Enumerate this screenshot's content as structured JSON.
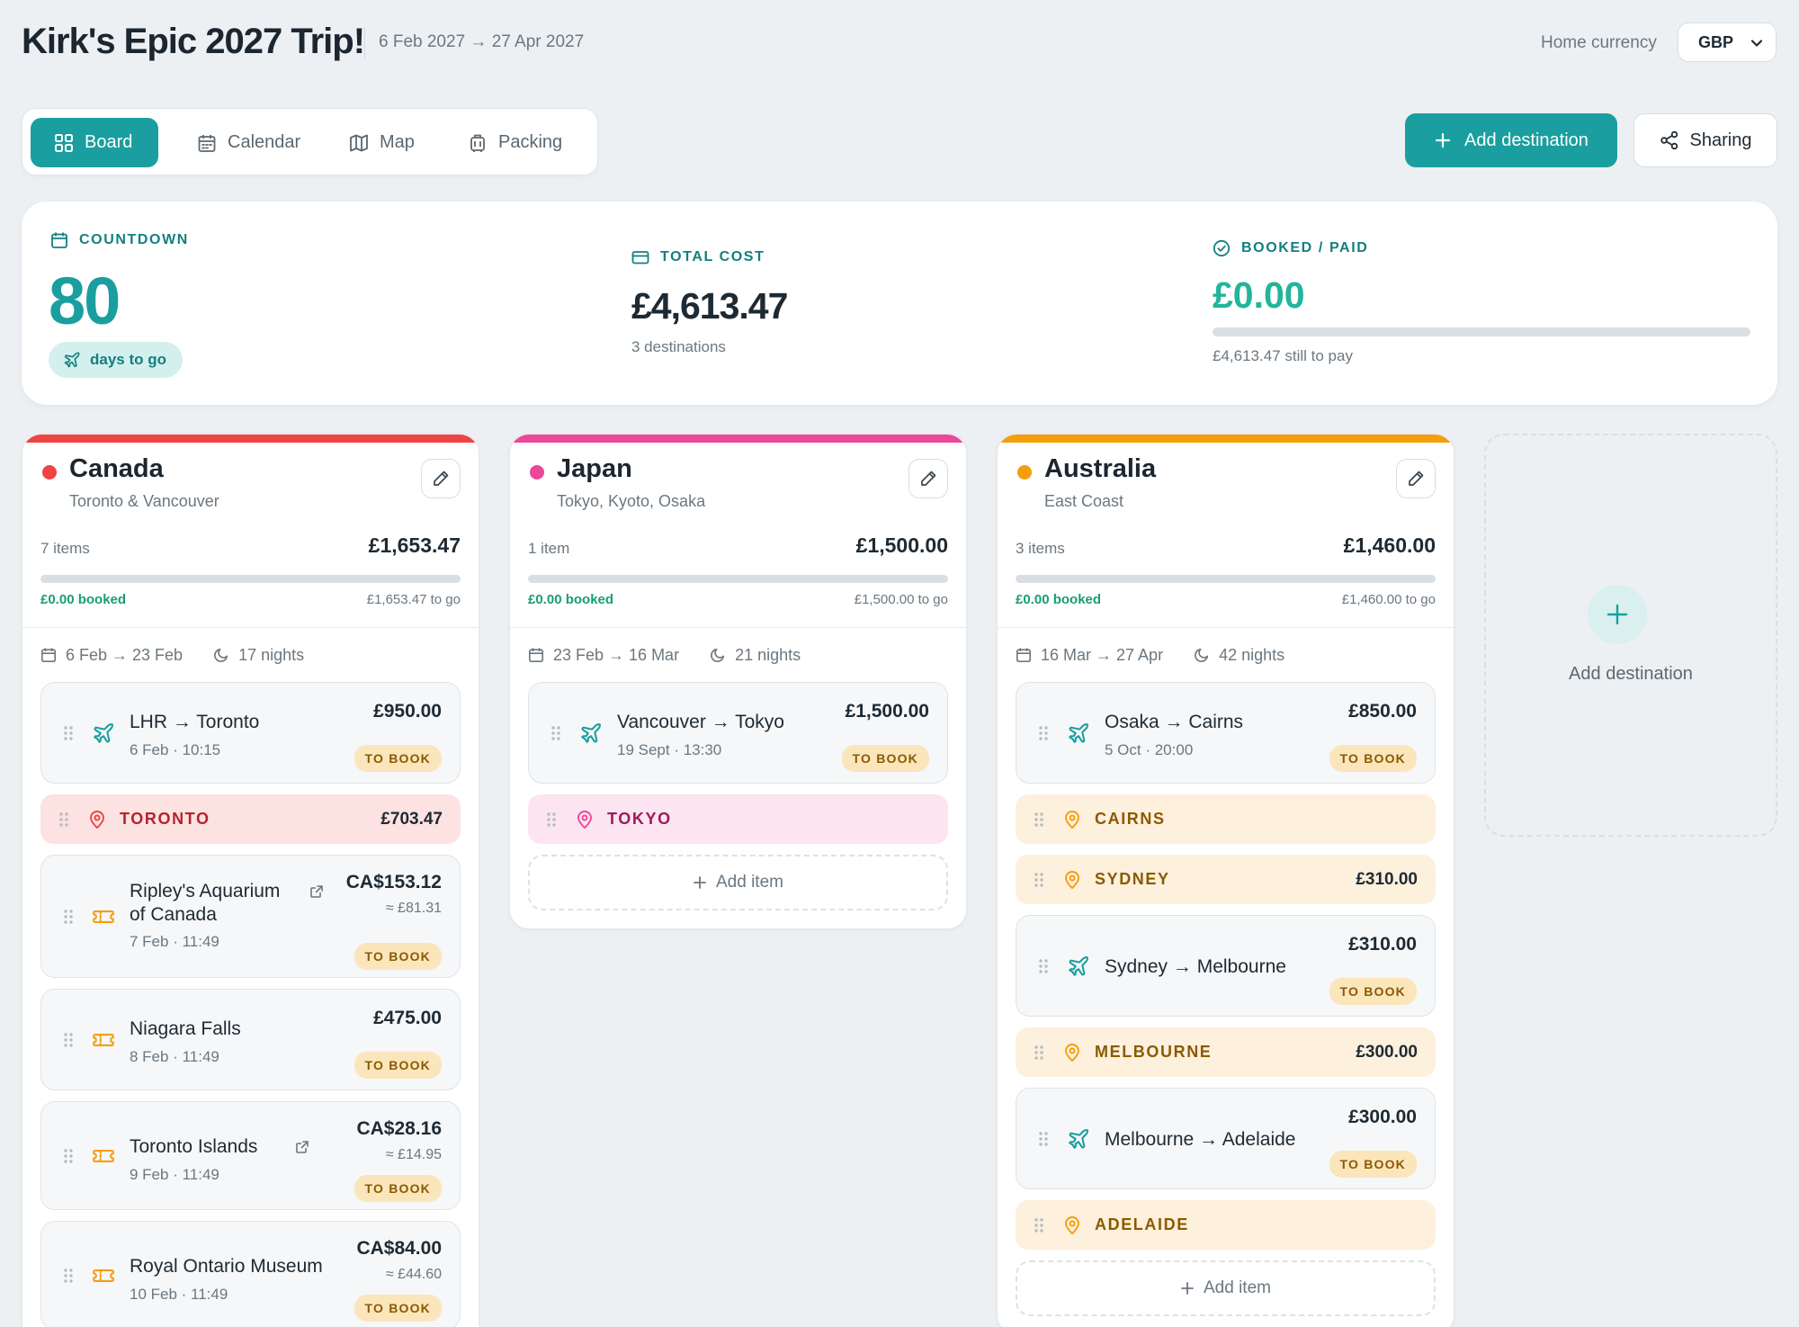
{
  "header": {
    "title": "Kirk's Epic 2027 Trip!",
    "dates": "6 Feb 2027 → 27 Apr 2027",
    "currency_label": "Home currency",
    "currency_value": "GBP"
  },
  "tabs": [
    {
      "label": "Board",
      "icon": "grid-icon",
      "active": true
    },
    {
      "label": "Calendar",
      "icon": "calendar-icon",
      "active": false
    },
    {
      "label": "Map",
      "icon": "map-icon",
      "active": false
    },
    {
      "label": "Packing",
      "icon": "luggage-icon",
      "active": false
    }
  ],
  "actions": {
    "add_destination": "Add destination",
    "sharing": "Sharing"
  },
  "summary": {
    "countdown_label": "COUNTDOWN",
    "countdown_value": "80",
    "countdown_pill": "days to go",
    "total_label": "TOTAL COST",
    "total_value": "£4,613.47",
    "total_sub": "3 destinations",
    "paid_label": "BOOKED / PAID",
    "paid_value": "£0.00",
    "paid_fraction": 0,
    "paid_sub": "£4,613.47 still to pay"
  },
  "colors": {
    "accent": "#1a9e9f",
    "canada": "#ef4444",
    "japan": "#ec4899",
    "australia": "#f59e0b"
  },
  "columns": [
    {
      "name": "Canada",
      "subtitle": "Toronto & Vancouver",
      "items": "7 items",
      "total": "£1,653.47",
      "booked": "£0.00 booked",
      "togo": "£1,653.47 to go",
      "booked_fraction": 0,
      "dates": "6 Feb → 23 Feb",
      "nights": "17 nights",
      "cards": [
        {
          "kind": "flight",
          "title": "LHR → Toronto",
          "meta": "6 Feb · 10:15",
          "price": "£950.00",
          "badge": "TO BOOK"
        },
        {
          "kind": "location",
          "title": "TORONTO",
          "price": "£703.47"
        },
        {
          "kind": "activity",
          "title": "Ripley's Aquarium of Canada",
          "meta": "7 Feb · 11:49",
          "price": "CA$153.12",
          "approx": "≈ £81.31",
          "badge": "TO BOOK",
          "link": true
        },
        {
          "kind": "activity",
          "title": "Niagara Falls",
          "meta": "8 Feb · 11:49",
          "price": "£475.00",
          "badge": "TO BOOK"
        },
        {
          "kind": "activity",
          "title": "Toronto Islands",
          "meta": "9 Feb · 11:49",
          "price": "CA$28.16",
          "approx": "≈ £14.95",
          "badge": "TO BOOK",
          "link": true
        },
        {
          "kind": "activity",
          "title": "Royal Ontario Museum",
          "meta": "10 Feb · 11:49",
          "price": "CA$84.00",
          "approx": "≈ £44.60",
          "badge": "TO BOOK"
        }
      ]
    },
    {
      "name": "Japan",
      "subtitle": "Tokyo, Kyoto, Osaka",
      "items": "1 item",
      "total": "£1,500.00",
      "booked": "£0.00 booked",
      "togo": "£1,500.00 to go",
      "booked_fraction": 0,
      "dates": "23 Feb → 16 Mar",
      "nights": "21 nights",
      "cards": [
        {
          "kind": "flight",
          "title": "Vancouver → Tokyo",
          "meta": "19 Sept · 13:30",
          "price": "£1,500.00",
          "badge": "TO BOOK"
        },
        {
          "kind": "location",
          "title": "TOKYO"
        }
      ],
      "add_item": "Add item"
    },
    {
      "name": "Australia",
      "subtitle": "East Coast",
      "items": "3 items",
      "total": "£1,460.00",
      "booked": "£0.00 booked",
      "togo": "£1,460.00 to go",
      "booked_fraction": 0,
      "dates": "16 Mar → 27 Apr",
      "nights": "42 nights",
      "cards": [
        {
          "kind": "flight",
          "title": "Osaka → Cairns",
          "meta": "5 Oct · 20:00",
          "price": "£850.00",
          "badge": "TO BOOK"
        },
        {
          "kind": "location",
          "title": "CAIRNS"
        },
        {
          "kind": "location",
          "title": "SYDNEY",
          "price": "£310.00"
        },
        {
          "kind": "flight",
          "title": "Sydney → Melbourne",
          "price": "£310.00",
          "badge": "TO BOOK"
        },
        {
          "kind": "location",
          "title": "MELBOURNE",
          "price": "£300.00"
        },
        {
          "kind": "flight",
          "title": "Melbourne → Adelaide",
          "price": "£300.00",
          "badge": "TO BOOK"
        },
        {
          "kind": "location",
          "title": "ADELAIDE"
        }
      ],
      "add_item": "Add item"
    }
  ],
  "ghost": {
    "label": "Add destination"
  }
}
